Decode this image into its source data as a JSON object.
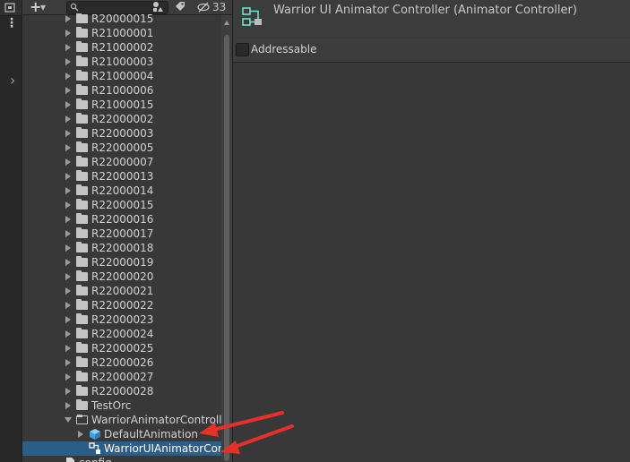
{
  "toolbar": {
    "add_label": "+",
    "add_arrow": "▾",
    "search_placeholder": "",
    "hidden_count": "33"
  },
  "left_strip": {
    "menu_glyph": "⋮",
    "expand_glyph": "›"
  },
  "tree": [
    {
      "label": "R20000015",
      "type": "folder",
      "expanded": false,
      "depth": 0
    },
    {
      "label": "R21000001",
      "type": "folder",
      "expanded": false,
      "depth": 0
    },
    {
      "label": "R21000002",
      "type": "folder",
      "expanded": false,
      "depth": 0
    },
    {
      "label": "R21000003",
      "type": "folder",
      "expanded": false,
      "depth": 0
    },
    {
      "label": "R21000004",
      "type": "folder",
      "expanded": false,
      "depth": 0
    },
    {
      "label": "R21000006",
      "type": "folder",
      "expanded": false,
      "depth": 0
    },
    {
      "label": "R21000015",
      "type": "folder",
      "expanded": false,
      "depth": 0
    },
    {
      "label": "R22000002",
      "type": "folder",
      "expanded": false,
      "depth": 0
    },
    {
      "label": "R22000003",
      "type": "folder",
      "expanded": false,
      "depth": 0
    },
    {
      "label": "R22000005",
      "type": "folder",
      "expanded": false,
      "depth": 0
    },
    {
      "label": "R22000007",
      "type": "folder",
      "expanded": false,
      "depth": 0
    },
    {
      "label": "R22000013",
      "type": "folder",
      "expanded": false,
      "depth": 0
    },
    {
      "label": "R22000014",
      "type": "folder",
      "expanded": false,
      "depth": 0
    },
    {
      "label": "R22000015",
      "type": "folder",
      "expanded": false,
      "depth": 0
    },
    {
      "label": "R22000016",
      "type": "folder",
      "expanded": false,
      "depth": 0
    },
    {
      "label": "R22000017",
      "type": "folder",
      "expanded": false,
      "depth": 0
    },
    {
      "label": "R22000018",
      "type": "folder",
      "expanded": false,
      "depth": 0
    },
    {
      "label": "R22000019",
      "type": "folder",
      "expanded": false,
      "depth": 0
    },
    {
      "label": "R22000020",
      "type": "folder",
      "expanded": false,
      "depth": 0
    },
    {
      "label": "R22000021",
      "type": "folder",
      "expanded": false,
      "depth": 0
    },
    {
      "label": "R22000022",
      "type": "folder",
      "expanded": false,
      "depth": 0
    },
    {
      "label": "R22000023",
      "type": "folder",
      "expanded": false,
      "depth": 0
    },
    {
      "label": "R22000024",
      "type": "folder",
      "expanded": false,
      "depth": 0
    },
    {
      "label": "R22000025",
      "type": "folder",
      "expanded": false,
      "depth": 0
    },
    {
      "label": "R22000026",
      "type": "folder",
      "expanded": false,
      "depth": 0
    },
    {
      "label": "R22000027",
      "type": "folder",
      "expanded": false,
      "depth": 0
    },
    {
      "label": "R22000028",
      "type": "folder",
      "expanded": false,
      "depth": 0
    },
    {
      "label": "TestOrc",
      "type": "folder",
      "expanded": false,
      "depth": 0
    },
    {
      "label": "WarriorAnimatorControlle",
      "type": "folder",
      "expanded": true,
      "depth": 0
    },
    {
      "label": "DefaultAnimation",
      "type": "model",
      "expanded": false,
      "depth": 1
    },
    {
      "label": "WarriorUIAnimatorCont",
      "type": "animator",
      "expanded": null,
      "depth": 1,
      "selected": true
    },
    {
      "label": "config",
      "type": "file",
      "expanded": null,
      "depth": -1
    }
  ],
  "inspector": {
    "title": "Warrior UI Animator Controller (Animator Controller)",
    "addressable_label": "Addressable",
    "addressable_checked": false
  },
  "colors": {
    "selection": "#2c5d87",
    "annotation_arrow": "#e8302a",
    "animator_icon": "#6fe0c8"
  }
}
